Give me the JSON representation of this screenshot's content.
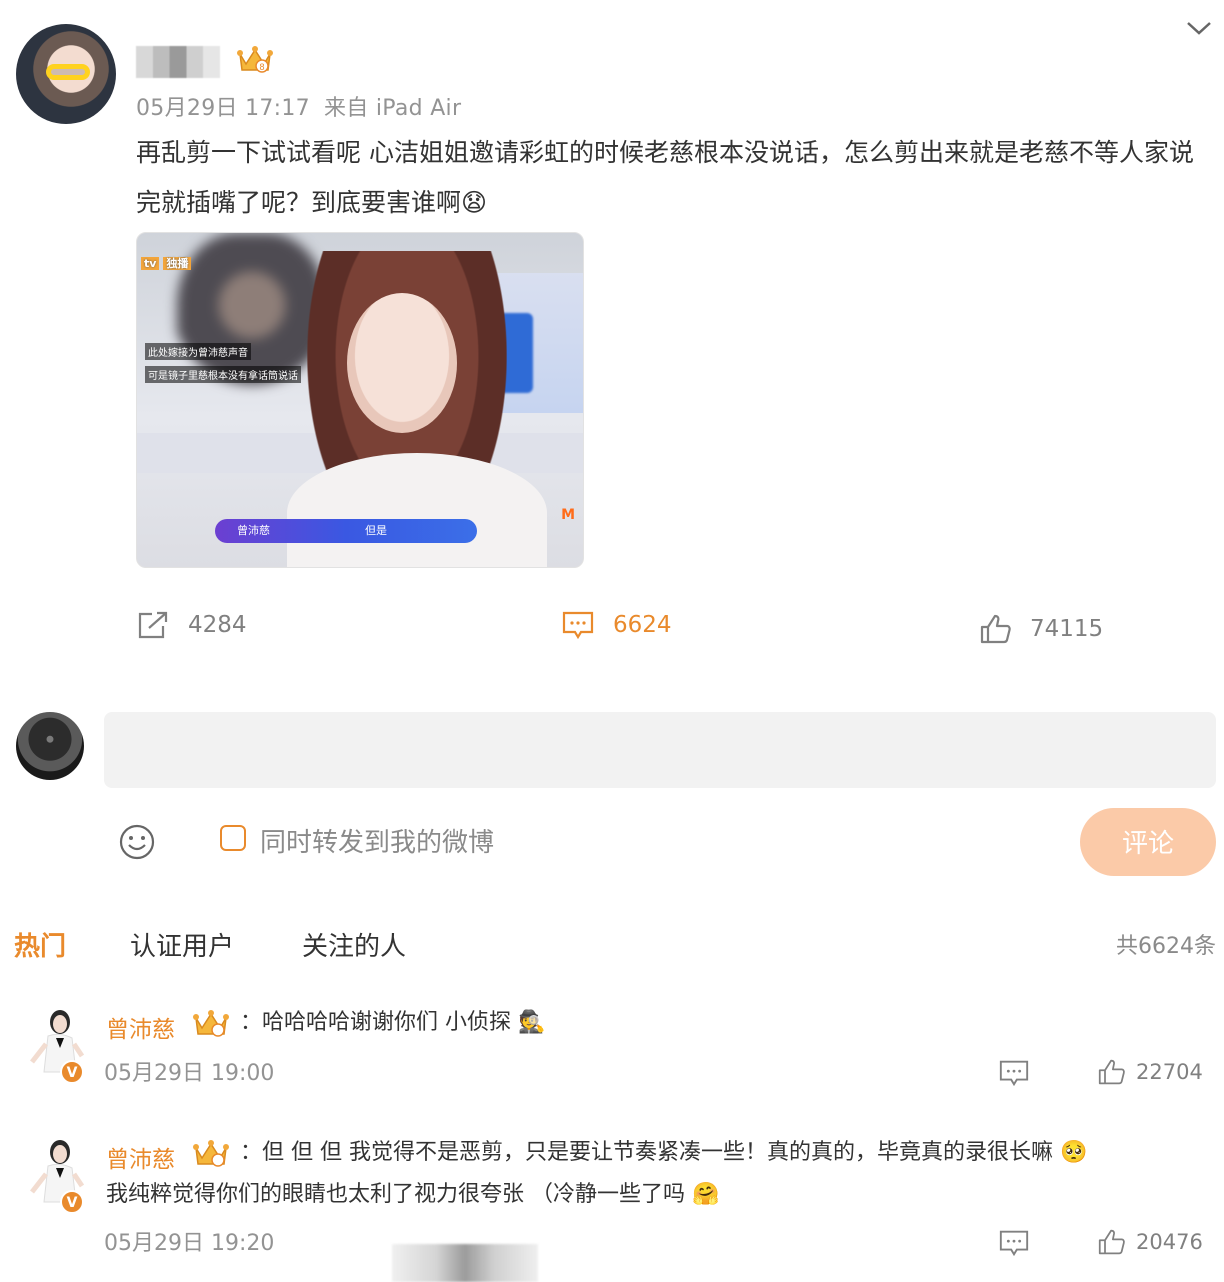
{
  "post": {
    "timestamp": "05月29日 17:17",
    "source": "来自 iPad Air",
    "text": "再乱剪一下试试看呢 心洁姐姐邀请彩虹的时候老慈根本没说话，怎么剪出来就是老慈不等人家说完就插嘴了呢？到底要害谁啊😧",
    "video": {
      "caption1": "此处嫁接为曾沛慈声音",
      "caption2": "可是镜子里慈根本没有拿话筒说话",
      "subtitle_name": "曾沛慈",
      "subtitle_text": "但是",
      "tv_logo": "tv",
      "tv_tag": "独播",
      "corner_logo": "M"
    },
    "stats": {
      "reposts": "4284",
      "comments": "6624",
      "likes": "74115"
    }
  },
  "compose": {
    "placeholder": "",
    "repost_label": "同时转发到我的微博",
    "submit_label": "评论"
  },
  "tabs": [
    {
      "label": "热门",
      "active": true
    },
    {
      "label": "认证用户",
      "active": false
    },
    {
      "label": "关注的人",
      "active": false
    }
  ],
  "total_label": "共6624条",
  "comments": [
    {
      "name": "曾沛慈",
      "text": "：哈哈哈哈谢谢你们 小侦探",
      "emoji": "🕵",
      "time": "05月29日 19:00",
      "likes": "22704",
      "verified": "V"
    },
    {
      "name": "曾沛慈",
      "text": "：但 但 但 我觉得不是恶剪，只是要让节奏紧凑一些！真的真的，毕竟真的录很长嘛",
      "emoji": "🥺",
      "text2": "我纯粹觉得你们的眼睛也太利了视力很夸张 （冷静一些了吗",
      "emoji2": "🤗",
      "time": "05月29日 19:20",
      "likes": "20476",
      "verified": "V"
    }
  ],
  "colors": {
    "accent": "#e98a2c",
    "muted": "#939393",
    "submit_bg": "#fbcaa8",
    "input_bg": "#f2f2f2"
  },
  "icons": [
    "chevron-down-icon",
    "crown-badge-icon",
    "repost-icon",
    "comment-icon",
    "like-icon",
    "emoji-icon"
  ]
}
